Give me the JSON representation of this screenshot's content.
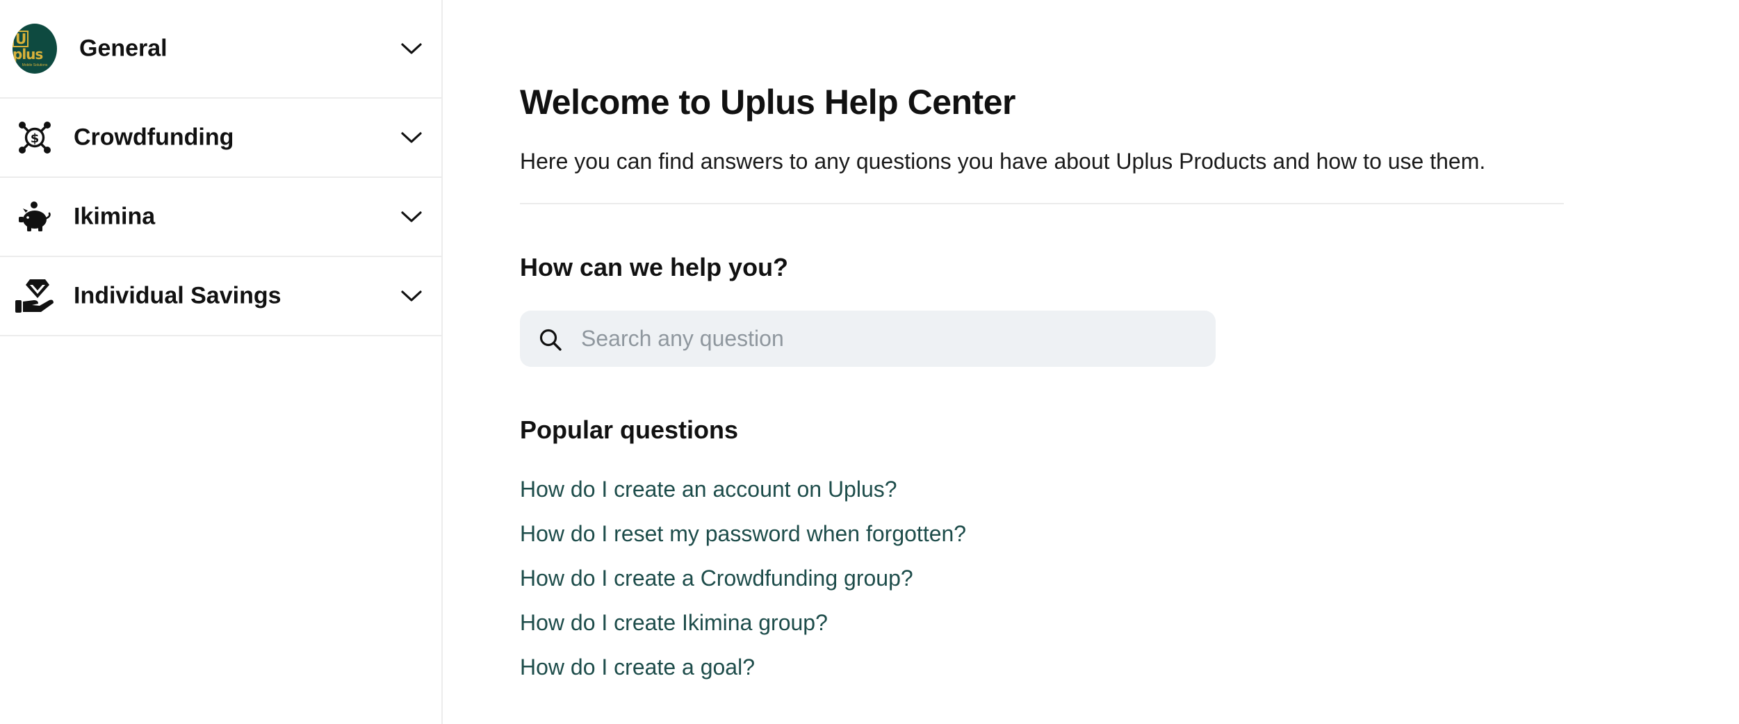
{
  "sidebar": {
    "items": [
      {
        "label": "General",
        "icon": "uplus-logo"
      },
      {
        "label": "Crowdfunding",
        "icon": "crowdfunding-icon"
      },
      {
        "label": "Ikimina",
        "icon": "piggy-bank-icon"
      },
      {
        "label": "Individual Savings",
        "icon": "hand-diamond-icon"
      }
    ],
    "logo": {
      "text_box": "U",
      "text_rest": "plus",
      "subtext": "Mobile Solutions"
    }
  },
  "main": {
    "title": "Welcome to Uplus Help Center",
    "intro": "Here you can find answers to any questions you have about Uplus Products and how to use them.",
    "help_heading": "How can we help you?",
    "search": {
      "placeholder": "Search any question",
      "value": ""
    },
    "popular_heading": "Popular questions",
    "questions": [
      "How do I create an account on Uplus?",
      "How do I reset my password when forgotten?",
      "How do I create a Crowdfunding group?",
      "How do I create Ikimina group?",
      "How do I create a goal?"
    ]
  },
  "colors": {
    "link": "#1d4c4a",
    "logo_bg": "#0e4a40",
    "logo_gold": "#d9b23a",
    "search_bg": "#eef1f4"
  }
}
